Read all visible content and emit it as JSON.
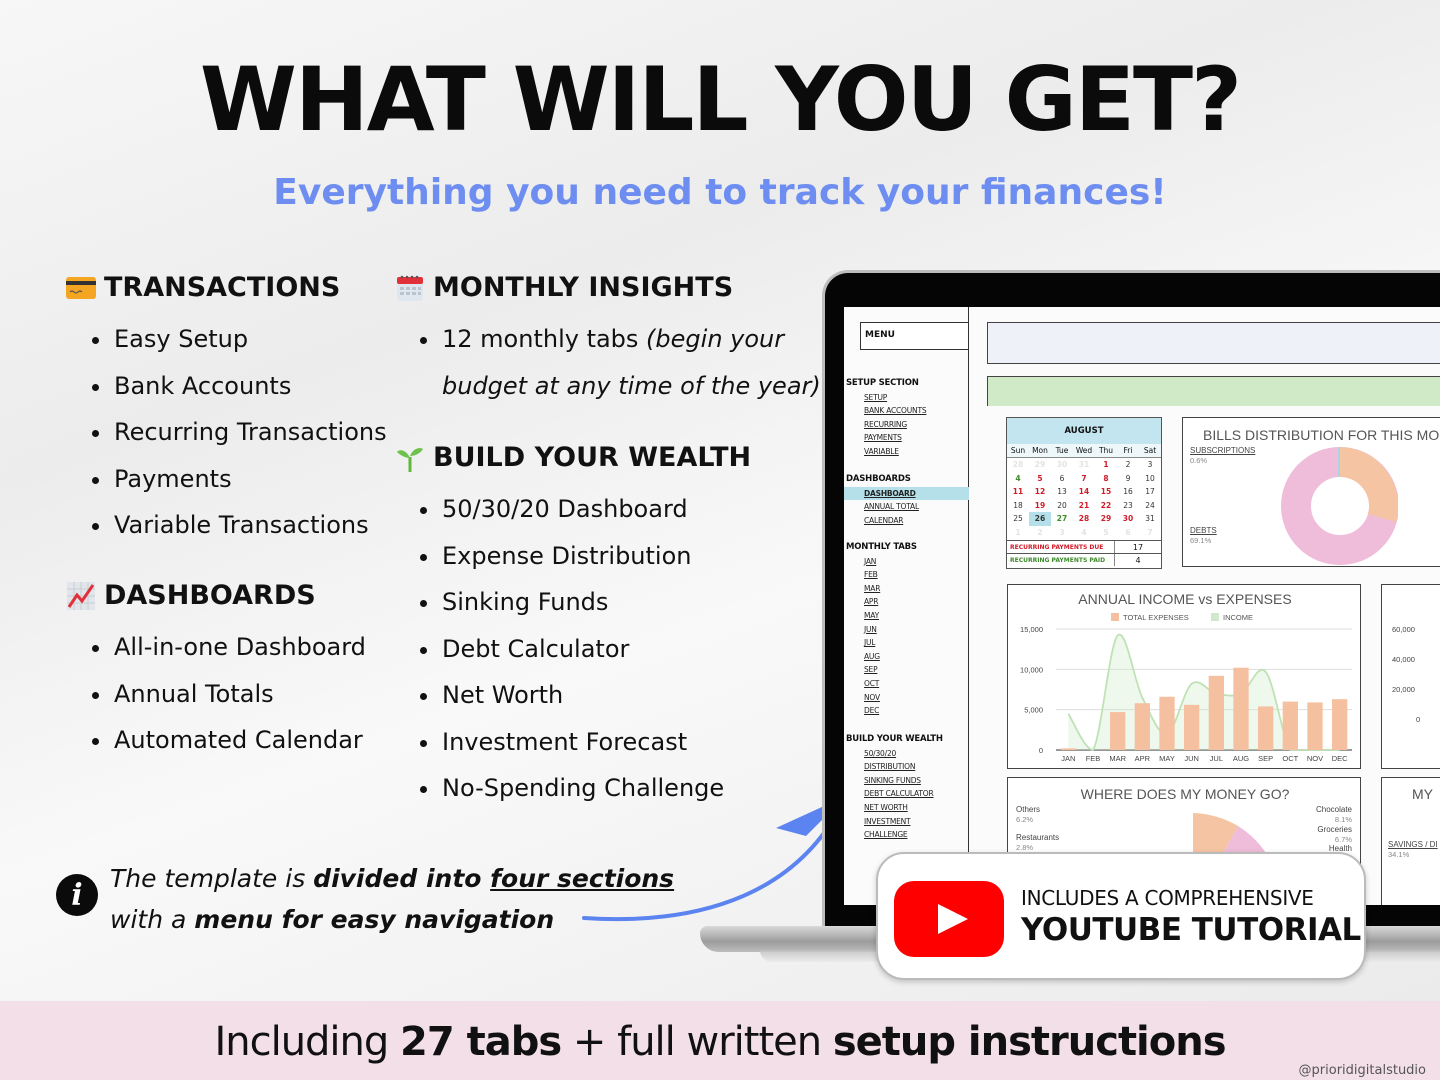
{
  "header": {
    "title": "WHAT WILL YOU GET?",
    "subtitle": "Everything you need to track your finances!",
    "subtitle_color": "#6d8ef0"
  },
  "sections": {
    "transactions": {
      "icon": "credit-card-icon",
      "title": "TRANSACTIONS",
      "items": [
        "Easy Setup",
        "Bank Accounts",
        "Recurring Transactions",
        "Payments",
        "Variable Transactions"
      ]
    },
    "dashboards": {
      "icon": "chart-increasing-icon",
      "title": "DASHBOARDS",
      "items": [
        "All-in-one Dashboard",
        "Annual Totals",
        "Automated Calendar"
      ]
    },
    "monthly_insights": {
      "icon": "calendar-icon",
      "title": "MONTHLY INSIGHTS",
      "item_main": "12 monthly tabs ",
      "item_italic_1": "(begin your",
      "item_italic_2": "budget at any time of the year)"
    },
    "build_wealth": {
      "icon": "seedling-icon",
      "title": "BUILD YOUR WEALTH",
      "items": [
        "50/30/20 Dashboard",
        "Expense Distribution",
        "Sinking Funds",
        "Debt Calculator",
        "Net Worth",
        "Investment Forecast",
        "No-Spending Challenge"
      ]
    }
  },
  "info_note": {
    "p1": "The template is ",
    "p2": "divided into ",
    "p3": "four sections",
    "p4": "with a ",
    "p5": "menu for easy navigation"
  },
  "spreadsheet": {
    "menu_label": "MENU",
    "groups": [
      {
        "title": "SETUP SECTION",
        "items": [
          "SETUP",
          "BANK ACCOUNTS",
          "RECURRING",
          "PAYMENTS",
          "VARIABLE"
        ]
      },
      {
        "title": "DASHBOARDS",
        "items": [
          "DASHBOARD",
          "ANNUAL TOTAL",
          "CALENDAR"
        ],
        "active": "DASHBOARD"
      },
      {
        "title": "MONTHLY TABS",
        "items": [
          "JAN",
          "FEB",
          "MAR",
          "APR",
          "MAY",
          "JUN",
          "JUL",
          "AUG",
          "SEP",
          "OCT",
          "NOV",
          "DEC"
        ]
      },
      {
        "title": "BUILD YOUR WEALTH",
        "items": [
          "50/30/20",
          "DISTRIBUTION",
          "SINKING FUNDS",
          "DEBT CALCULATOR",
          "NET WORTH",
          "INVESTMENT",
          "CHALLENGE"
        ]
      }
    ],
    "calendar": {
      "month": "AUGUST",
      "days_of_week": [
        "Sun",
        "Mon",
        "Tue",
        "Wed",
        "Thu",
        "Fri",
        "Sat"
      ],
      "weeks": [
        [
          [
            "28",
            "fade"
          ],
          [
            "29",
            "fade"
          ],
          [
            "30",
            "fade"
          ],
          [
            "31",
            "fade"
          ],
          [
            "1",
            "red"
          ],
          [
            "2",
            "norm"
          ],
          [
            "3",
            "norm"
          ]
        ],
        [
          [
            "4",
            "green"
          ],
          [
            "5",
            "red"
          ],
          [
            "6",
            "norm"
          ],
          [
            "7",
            "red"
          ],
          [
            "8",
            "red"
          ],
          [
            "9",
            "norm"
          ],
          [
            "10",
            "norm"
          ]
        ],
        [
          [
            "11",
            "red"
          ],
          [
            "12",
            "red"
          ],
          [
            "13",
            "norm"
          ],
          [
            "14",
            "red"
          ],
          [
            "15",
            "red"
          ],
          [
            "16",
            "norm"
          ],
          [
            "17",
            "norm"
          ]
        ],
        [
          [
            "18",
            "norm"
          ],
          [
            "19",
            "red"
          ],
          [
            "20",
            "norm"
          ],
          [
            "21",
            "red"
          ],
          [
            "22",
            "red"
          ],
          [
            "23",
            "norm"
          ],
          [
            "24",
            "norm"
          ]
        ],
        [
          [
            "25",
            "norm"
          ],
          [
            "26",
            "today"
          ],
          [
            "27",
            "green"
          ],
          [
            "28",
            "red"
          ],
          [
            "29",
            "red"
          ],
          [
            "30",
            "red"
          ],
          [
            "31",
            "norm"
          ]
        ],
        [
          [
            "1",
            "fade"
          ],
          [
            "2",
            "fade"
          ],
          [
            "3",
            "fade"
          ],
          [
            "4",
            "fade"
          ],
          [
            "5",
            "fade"
          ],
          [
            "6",
            "fade"
          ],
          [
            "7",
            "fade"
          ]
        ]
      ],
      "recurring_due_label": "RECURRING PAYMENTS DUE",
      "recurring_due_value": "17",
      "recurring_paid_label": "RECURRING PAYMENTS PAID",
      "recurring_paid_value": "4"
    },
    "bills_chart": {
      "title": "BILLS DISTRIBUTION FOR THIS MO",
      "labels": [
        {
          "name": "SUBSCRIPTIONS",
          "pct": "0.6%"
        },
        {
          "name": "DEBTS",
          "pct": "69.1%"
        }
      ]
    },
    "savings_card": {
      "title": "MY",
      "label": "SAVINGS / DI",
      "pct": "34.1%"
    },
    "side_axis_ticks": [
      "60,000",
      "40,000",
      "20,000",
      "0"
    ],
    "money_chart": {
      "title": "WHERE DOES MY MONEY GO?",
      "labels_left": [
        {
          "name": "Others",
          "pct": "6.2%"
        },
        {
          "name": "Restaurants",
          "pct": "2.8%"
        }
      ],
      "labels_right": [
        {
          "name": "Chocolate",
          "pct": "8.1%"
        },
        {
          "name": "Groceries",
          "pct": "6.7%"
        },
        {
          "name": "Health",
          "pct": ""
        }
      ]
    }
  },
  "chart_data": {
    "type": "bar",
    "title": "ANNUAL INCOME vs EXPENSES",
    "categories": [
      "JAN",
      "FEB",
      "MAR",
      "APR",
      "MAY",
      "JUN",
      "JUL",
      "AUG",
      "SEP",
      "OCT",
      "NOV",
      "DEC"
    ],
    "series": [
      {
        "name": "TOTAL EXPENSES",
        "type": "bar",
        "color": "#f5c0a0",
        "values": [
          200,
          0,
          4700,
          5800,
          6600,
          5600,
          9200,
          10200,
          5400,
          6000,
          5900,
          6300
        ]
      },
      {
        "name": "INCOME",
        "type": "area",
        "color": "#cfeac8",
        "values": [
          4500,
          0,
          14200,
          6500,
          2000,
          8200,
          7000,
          7000,
          9700,
          0,
          0,
          0
        ]
      }
    ],
    "yticks": [
      "0",
      "5,000",
      "10,000",
      "15,000"
    ],
    "ylim": [
      0,
      15000
    ],
    "legend": "top",
    "grid": true
  },
  "youtube_badge": {
    "line1": "INCLUDES A COMPREHENSIVE",
    "line2": "YOUTUBE TUTORIAL"
  },
  "footer": {
    "t1": "Including ",
    "t2": "27 tabs",
    "t3": " + full written ",
    "t4": "setup instructions",
    "handle": "@prioridigitalstudio",
    "bg_color": "#f3dfe8"
  }
}
